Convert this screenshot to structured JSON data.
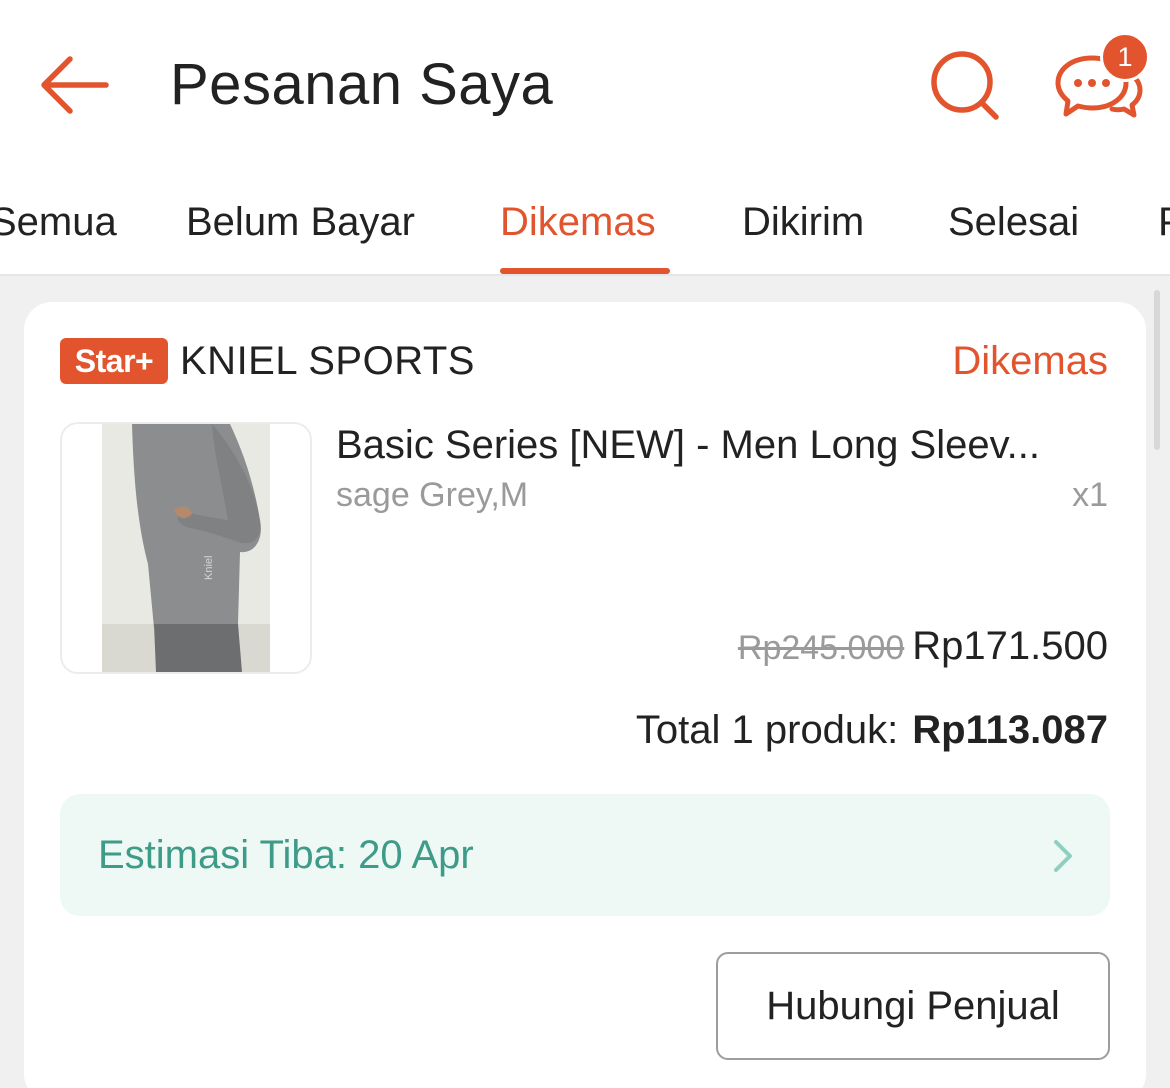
{
  "header": {
    "title": "Pesanan Saya",
    "back_icon": "back-arrow-icon",
    "search_icon": "search-icon",
    "chat_icon": "chat-bubbles-icon",
    "chat_badge_count": "1"
  },
  "tabs": [
    {
      "label": "Semua"
    },
    {
      "label": "Belum Bayar"
    },
    {
      "label": "Dikemas",
      "active": true
    },
    {
      "label": "Dikirim"
    },
    {
      "label": "Selesai"
    },
    {
      "label": "P"
    }
  ],
  "order": {
    "badge": "Star+",
    "shop_name": "KNIEL SPORTS",
    "status": "Dikemas",
    "product": {
      "title": "Basic Series [NEW] - Men Long Sleev...",
      "variant": "sage Grey,M",
      "quantity": "x1",
      "price_original": "Rp245.000",
      "price_final": "Rp171.500"
    },
    "total_label": "Total 1 produk:",
    "total_amount": "Rp113.087",
    "eta": "Estimasi Tiba: 20 Apr",
    "contact_button": "Hubungi Penjual"
  },
  "colors": {
    "accent": "#e2542e",
    "eta_text": "#3d9b87",
    "eta_bg": "#eef9f6"
  }
}
